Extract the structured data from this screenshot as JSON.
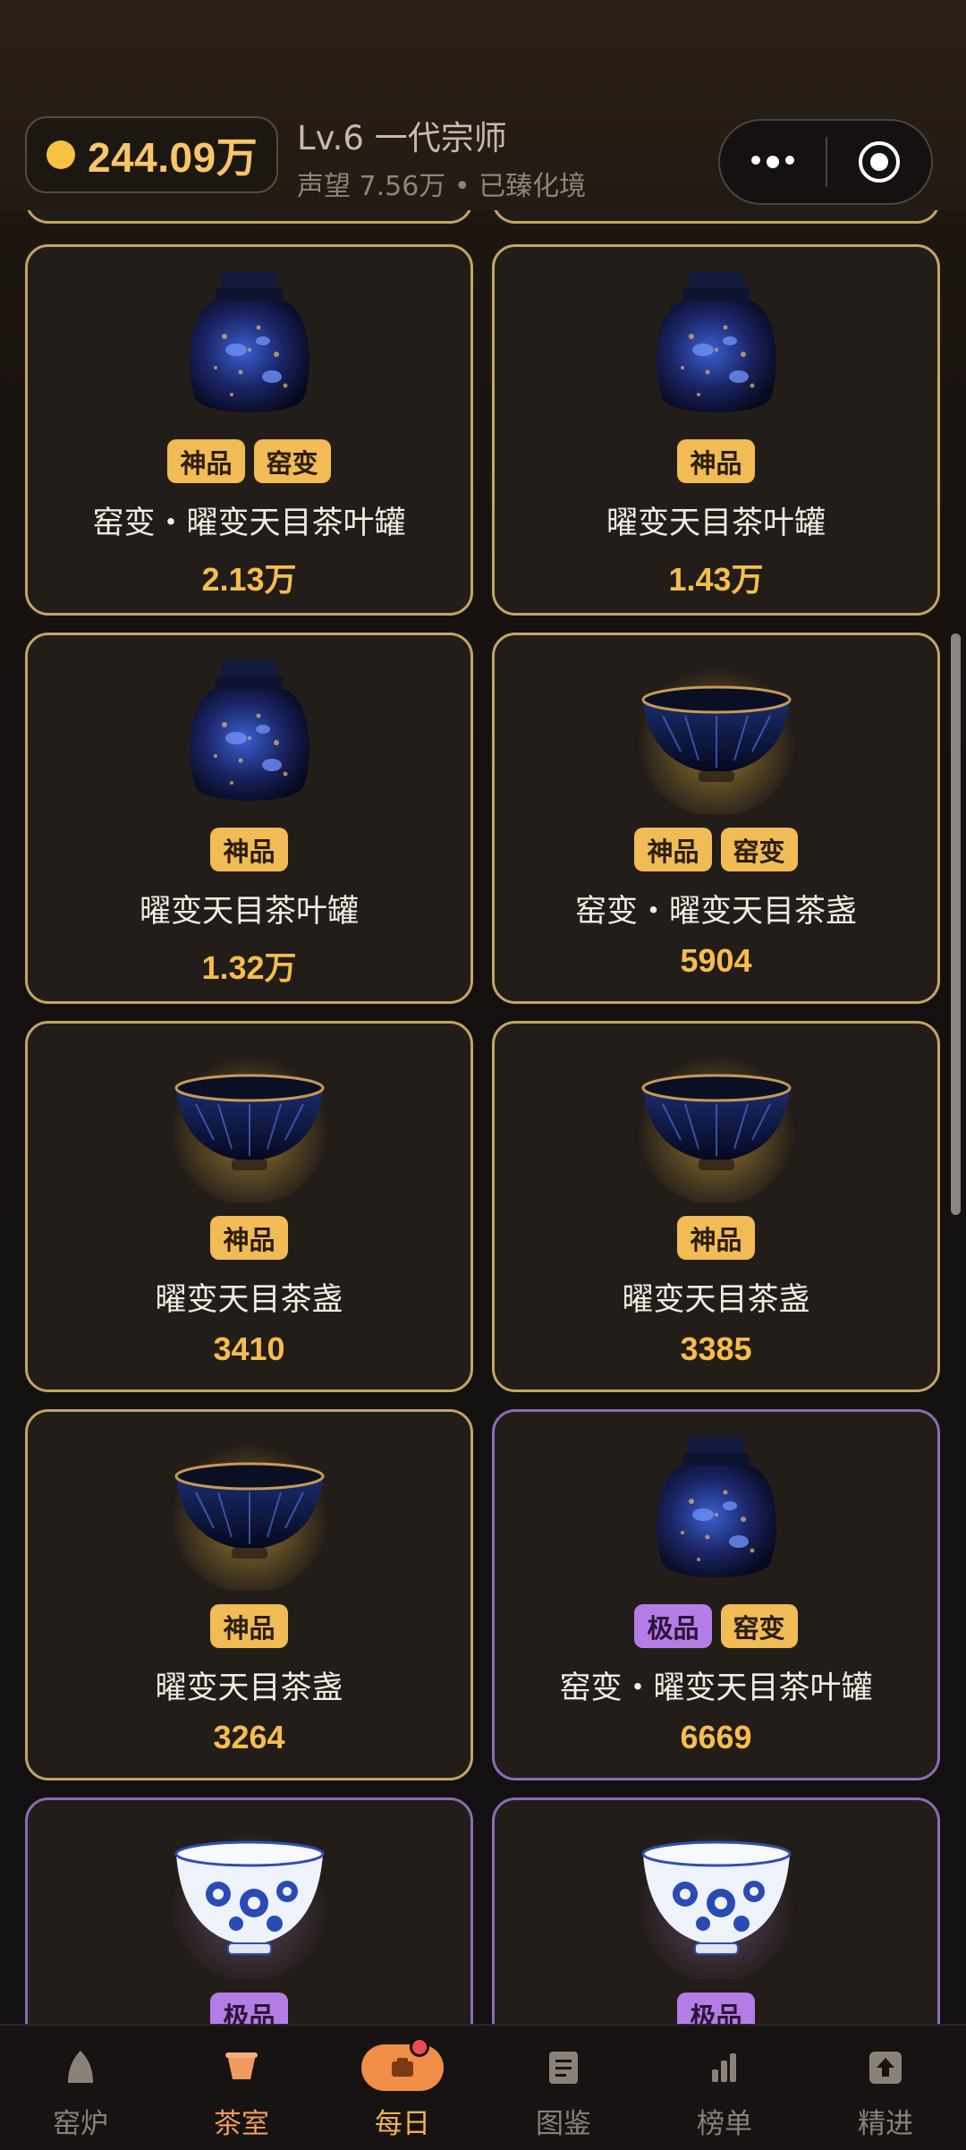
{
  "header": {
    "coins": "244.09万",
    "level_title": "Lv.6 一代宗师",
    "subline": "声望 7.56万 • 已臻化境"
  },
  "cards": [
    {
      "badges": [
        "神品",
        "窑变"
      ],
      "name": "窑变・曜变天目茶叶罐",
      "price": "2.13万",
      "type": "jar",
      "tier": "gold"
    },
    {
      "badges": [
        "神品"
      ],
      "name": "曜变天目茶叶罐",
      "price": "1.43万",
      "type": "jar",
      "tier": "gold"
    },
    {
      "badges": [
        "神品"
      ],
      "name": "曜变天目茶叶罐",
      "price": "1.32万",
      "type": "jar",
      "tier": "gold"
    },
    {
      "badges": [
        "神品",
        "窑变"
      ],
      "name": "窑变・曜变天目茶盏",
      "price": "5904",
      "type": "bowl",
      "tier": "gold"
    },
    {
      "badges": [
        "神品"
      ],
      "name": "曜变天目茶盏",
      "price": "3410",
      "type": "bowl",
      "tier": "gold"
    },
    {
      "badges": [
        "神品"
      ],
      "name": "曜变天目茶盏",
      "price": "3385",
      "type": "bowl",
      "tier": "gold"
    },
    {
      "badges": [
        "神品"
      ],
      "name": "曜变天目茶盏",
      "price": "3264",
      "type": "bowl",
      "tier": "gold"
    },
    {
      "badges": [
        "极品",
        "窑变"
      ],
      "name": "窑变・曜变天目茶叶罐",
      "price": "6669",
      "type": "jar",
      "tier": "purple"
    },
    {
      "badges": [
        "极品"
      ],
      "name": "",
      "price": "",
      "type": "cup",
      "tier": "purple"
    },
    {
      "badges": [
        "极品"
      ],
      "name": "",
      "price": "",
      "type": "cup",
      "tier": "purple"
    }
  ],
  "nav": [
    {
      "label": "窑炉",
      "icon": "kiln-icon"
    },
    {
      "label": "茶室",
      "icon": "tea-cup-icon"
    },
    {
      "label": "每日",
      "icon": "daily-box-icon"
    },
    {
      "label": "图鉴",
      "icon": "catalog-icon"
    },
    {
      "label": "榜单",
      "icon": "ranking-icon"
    },
    {
      "label": "精进",
      "icon": "upgrade-icon"
    }
  ],
  "colors": {
    "gold_badge": "#f1bb55",
    "purple_badge": "#b47de6",
    "price": "#f6bd4e",
    "active_tab": "#f09a62"
  }
}
